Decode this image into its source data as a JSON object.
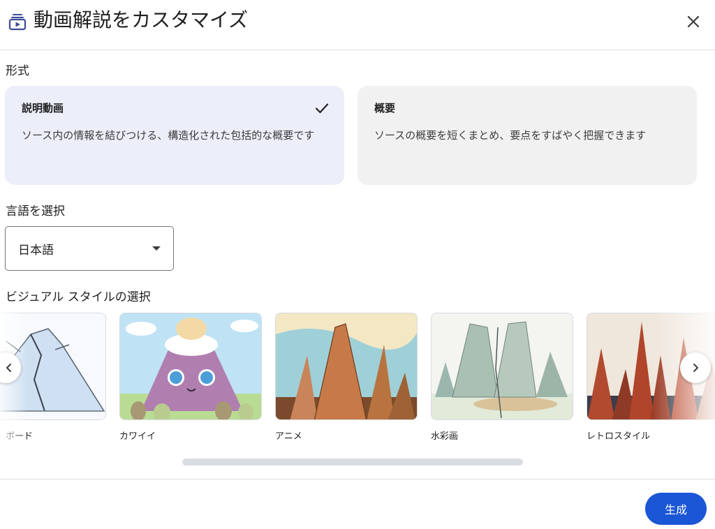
{
  "dialog": {
    "title": "動画解説をカスタマイズ",
    "icon": "video-summary-icon",
    "close_icon": "close-icon"
  },
  "format": {
    "label": "形式",
    "options": [
      {
        "title": "説明動画",
        "description": "ソース内の情報を結びつける、構造化された包括的な概要です",
        "selected": true
      },
      {
        "title": "概要",
        "description": "ソースの概要を短くまとめ、要点をすばやく把握できます",
        "selected": false
      }
    ]
  },
  "language": {
    "label": "言語を選択",
    "selected": "日本語"
  },
  "visual_style": {
    "label": "ビジュアル スタイルの選択",
    "items": [
      {
        "label": "ボード"
      },
      {
        "label": "カワイイ"
      },
      {
        "label": "アニメ"
      },
      {
        "label": "水彩画"
      },
      {
        "label": "レトロスタイル"
      }
    ]
  },
  "footer": {
    "generate_label": "生成"
  },
  "colors": {
    "accent": "#1a56d6",
    "selected_card": "#eceef9",
    "card": "#f1f1f2"
  }
}
